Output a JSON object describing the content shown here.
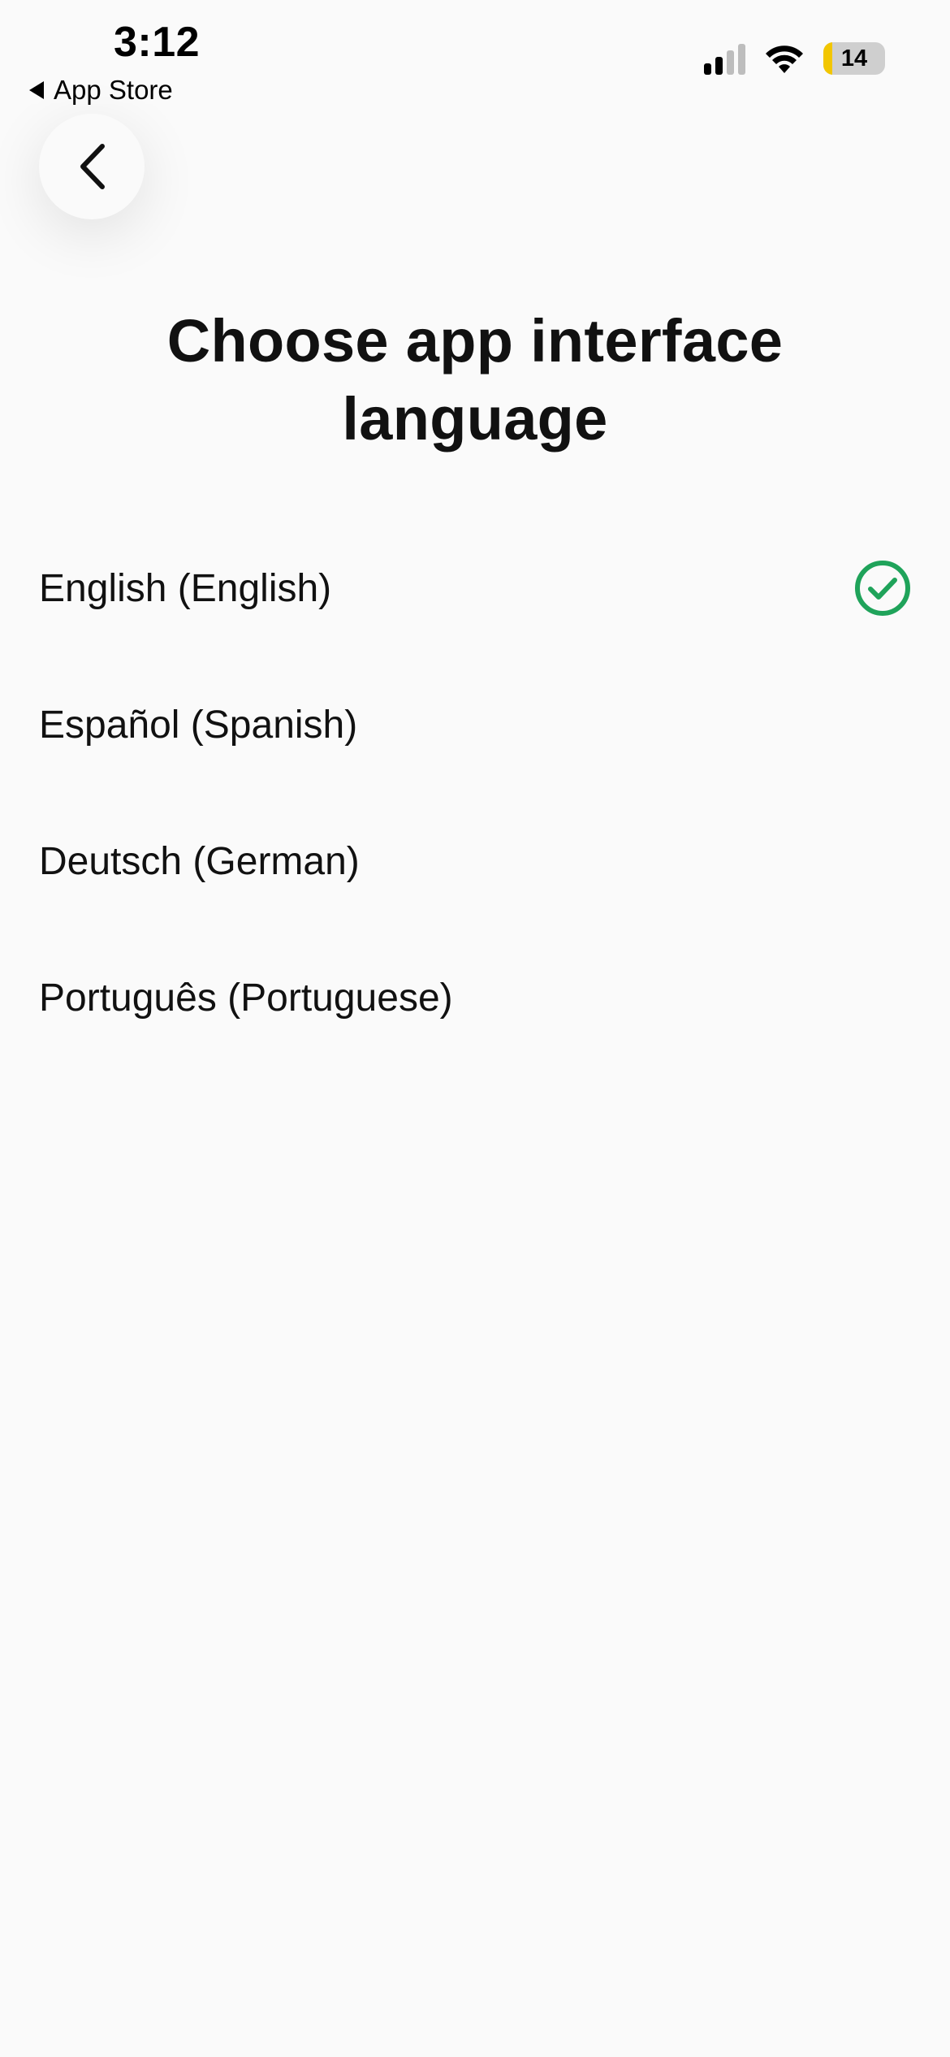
{
  "status_bar": {
    "time": "3:12",
    "back_to_app": "App Store",
    "battery_level": "14",
    "signal_bars_active": 2,
    "signal_bars_total": 4
  },
  "header": {
    "back_icon": "chevron-left-icon",
    "title_line1": "Choose app interface",
    "title_line2": "language"
  },
  "languages": [
    {
      "label": "English (English)",
      "selected": true
    },
    {
      "label": "Español (Spanish)",
      "selected": false
    },
    {
      "label": "Deutsch (German)",
      "selected": false
    },
    {
      "label": "Português (Portuguese)",
      "selected": false
    }
  ],
  "colors": {
    "background": "#fafafa",
    "accent_check": "#1fa35a",
    "battery_low": "#f2c600"
  }
}
